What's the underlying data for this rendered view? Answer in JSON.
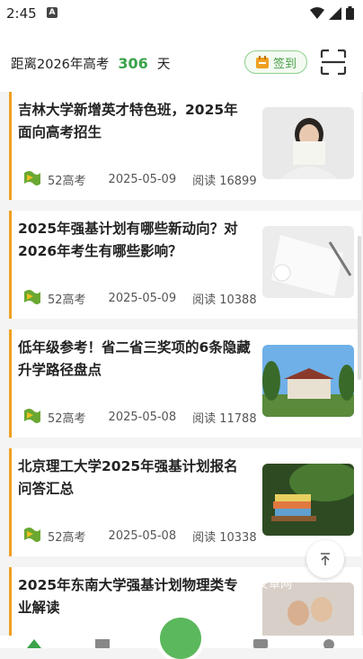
{
  "status_bar": {
    "time": "2:45",
    "app_badge": "A"
  },
  "header": {
    "countdown_prefix": "距离2026年高考",
    "countdown_days": "306",
    "countdown_unit": "天",
    "signin_label": "签到"
  },
  "articles": [
    {
      "title": "吉林大学新增英才特色班，2025年面向高考招生",
      "source": "52高考",
      "date": "2025-05-09",
      "reads": "阅读 16899",
      "image": "woman-reading"
    },
    {
      "title": "2025年强基计划有哪些新动向？对2026年考生有哪些影响？",
      "source": "52高考",
      "date": "2025-05-09",
      "reads": "阅读 10388",
      "image": "notebook-pen"
    },
    {
      "title": "低年级参考！省二省三奖项的6条隐藏升学路径盘点",
      "source": "52高考",
      "date": "2025-05-08",
      "reads": "阅读 11788",
      "image": "campus-building"
    },
    {
      "title": "北京理工大学2025年强基计划报名问答汇总",
      "source": "52高考",
      "date": "2025-05-08",
      "reads": "阅读 10338",
      "image": "books-swing"
    },
    {
      "title": "2025年东南大学强基计划物理类专业解读",
      "source": "52高考",
      "date": "",
      "reads": "",
      "image": "people-photo"
    }
  ],
  "watermark": "安卓网",
  "colors": {
    "accent_green": "#3aa34a",
    "card_border": "#f0a020"
  }
}
